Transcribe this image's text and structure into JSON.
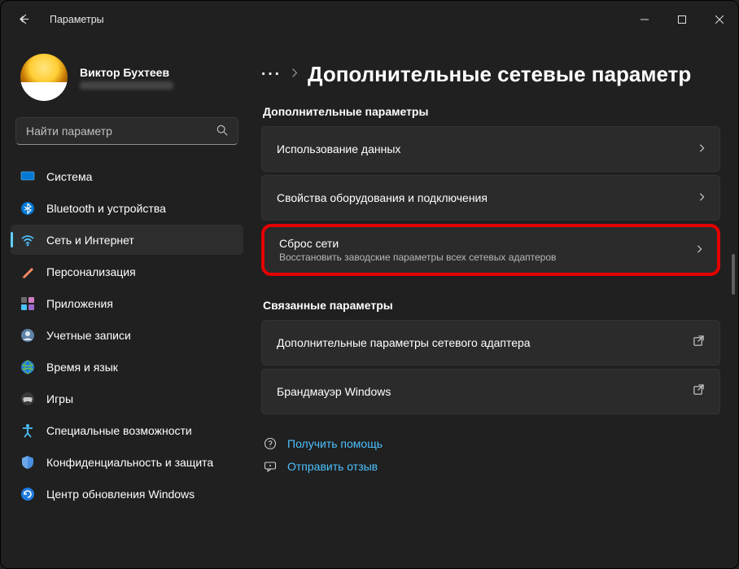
{
  "window": {
    "title": "Параметры"
  },
  "user": {
    "name": "Виктор Бухтеев"
  },
  "search": {
    "placeholder": "Найти параметр"
  },
  "nav": {
    "items": [
      {
        "label": "Система"
      },
      {
        "label": "Bluetooth и устройства"
      },
      {
        "label": "Сеть и Интернет"
      },
      {
        "label": "Персонализация"
      },
      {
        "label": "Приложения"
      },
      {
        "label": "Учетные записи"
      },
      {
        "label": "Время и язык"
      },
      {
        "label": "Игры"
      },
      {
        "label": "Специальные возможности"
      },
      {
        "label": "Конфиденциальность и защита"
      },
      {
        "label": "Центр обновления Windows"
      }
    ]
  },
  "breadcrumb": {
    "overflow": "···",
    "current": "Дополнительные сетевые параметр"
  },
  "sections": {
    "advanced": {
      "label": "Дополнительные параметры",
      "items": [
        {
          "title": "Использование данных"
        },
        {
          "title": "Свойства оборудования и подключения"
        },
        {
          "title": "Сброс сети",
          "subtitle": "Восстановить заводские параметры всех сетевых адаптеров"
        }
      ]
    },
    "related": {
      "label": "Связанные параметры",
      "items": [
        {
          "title": "Дополнительные параметры сетевого адаптера"
        },
        {
          "title": "Брандмауэр Windows"
        }
      ]
    }
  },
  "help": {
    "get_help": "Получить помощь",
    "feedback": "Отправить отзыв"
  }
}
